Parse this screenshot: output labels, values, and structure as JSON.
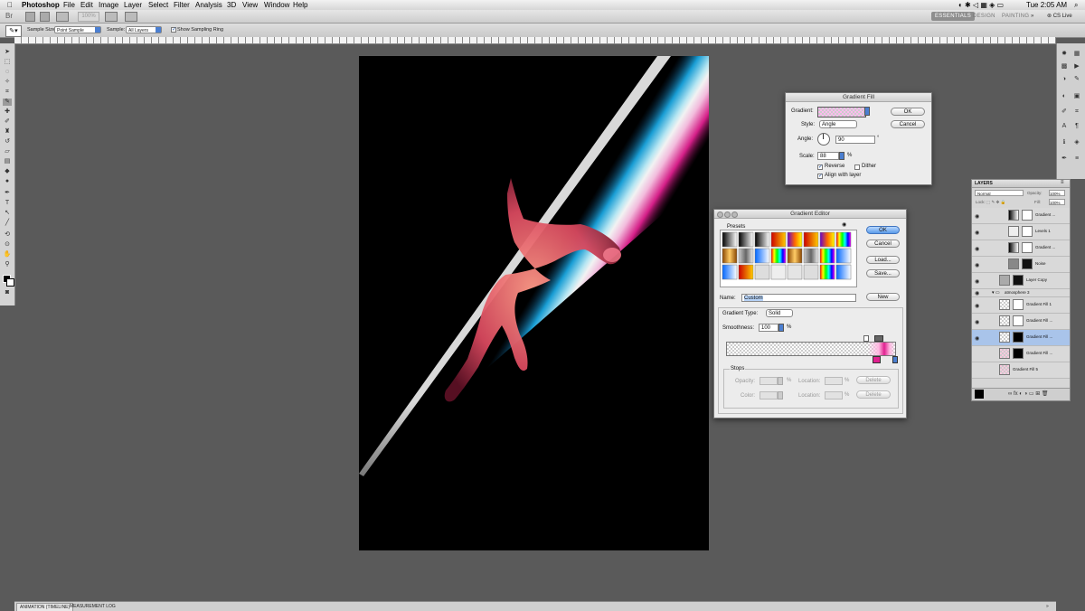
{
  "menubar": {
    "apple": "",
    "app_name": "Photoshop",
    "menus": [
      "File",
      "Edit",
      "Image",
      "Layer",
      "Select",
      "Filter",
      "Analysis",
      "3D",
      "View",
      "Window",
      "Help"
    ],
    "clock": "Tue 2:05 AM"
  },
  "appbar": {
    "zoom": "100%",
    "workspaces": [
      "ESSENTIALS",
      "DESIGN",
      "PAINTING"
    ],
    "active_workspace": "ESSENTIALS",
    "cs_live": "CS Live"
  },
  "options": {
    "sample_size_label": "Sample Size:",
    "sample_size_value": "Point Sample",
    "sample_label": "Sample:",
    "sample_value": "All Layers",
    "show_ring_label": "Show Sampling Ring"
  },
  "gradient_fill": {
    "title": "Gradient Fill",
    "gradient_label": "Gradient:",
    "style_label": "Style:",
    "style_value": "Angle",
    "angle_label": "Angle:",
    "angle_value": "90",
    "degree_symbol": "°",
    "scale_label": "Scale:",
    "scale_value": "88",
    "percent": "%",
    "reverse_label": "Reverse",
    "reverse_checked": true,
    "dither_label": "Dither",
    "dither_checked": false,
    "align_label": "Align with layer",
    "align_checked": true,
    "ok": "OK",
    "cancel": "Cancel"
  },
  "gradient_editor": {
    "title": "Gradient Editor",
    "presets_label": "Presets",
    "ok": "OK",
    "reset": "Cancel",
    "load": "Load...",
    "save": "Save...",
    "name_label": "Name:",
    "name_value": "Custom",
    "new": "New",
    "type_label": "Gradient Type:",
    "type_value": "Solid",
    "smoothness_label": "Smoothness:",
    "smoothness_value": "100",
    "percent": "%",
    "stops_label": "Stops",
    "opacity_label": "Opacity:",
    "color_label": "Color:",
    "location_label": "Location:",
    "delete": "Delete"
  },
  "layers_panel": {
    "title": "LAYERS",
    "blend_mode": "Normal",
    "opacity_label": "Opacity:",
    "opacity_value": "100%",
    "fill_label": "Fill:",
    "fill_value": "100%",
    "layers": [
      {
        "name": "Gradient ...",
        "selected": false,
        "thumb": "gradient"
      },
      {
        "name": "Levels 1",
        "selected": false,
        "thumb": "levels"
      },
      {
        "name": "Gradient ...",
        "selected": false,
        "thumb": "gradient"
      },
      {
        "name": "Noise",
        "selected": false,
        "thumb": "dark"
      },
      {
        "name": "Layer Copy",
        "selected": false,
        "thumb": "dark"
      },
      {
        "name": "atmosphere 3",
        "selected": false,
        "thumb": "folder"
      },
      {
        "name": "Gradient Fill 1",
        "selected": false,
        "thumb": "checker"
      },
      {
        "name": "Gradient Fill ...",
        "selected": false,
        "thumb": "checker"
      },
      {
        "name": "Gradient Fill ...",
        "selected": true,
        "thumb": "checker"
      },
      {
        "name": "Gradient Fill ...",
        "selected": false,
        "thumb": "pinkchecker"
      },
      {
        "name": "Gradient Fill 5",
        "selected": false,
        "thumb": "pinkchecker"
      }
    ]
  },
  "bottom_tabs": [
    "ANIMATION (TIMELINE)",
    "MEASUREMENT LOG"
  ],
  "colors": {
    "canvas_bg": "#000000",
    "app_bg": "#5a5a5a",
    "cyan_beam": "#29c9f2",
    "magenta_beam": "#e0208f",
    "selection_blue": "#a9c4ea"
  }
}
